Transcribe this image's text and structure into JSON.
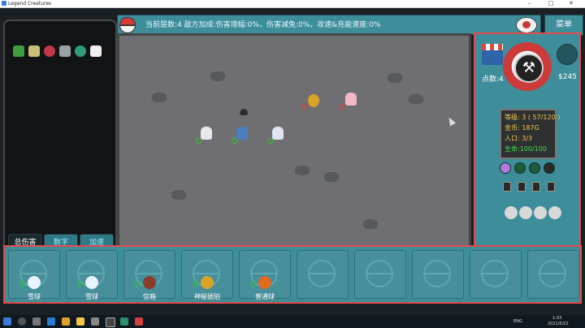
{
  "window": {
    "title": "Legend Creatures"
  },
  "topbar": {
    "info": "当前层数:4 敌方加成:伤害增幅:0%，伤害减免:0%，攻速&充能速度:0%"
  },
  "menu_label": "菜单",
  "left_panel": {
    "items": [
      "book-icon",
      "stack-icon",
      "berry-icon",
      "net-icon",
      "orb-icon",
      "wing-icon"
    ],
    "buttons": {
      "damage": "总伤害",
      "number": "数字",
      "speed": "加速"
    }
  },
  "right_panel": {
    "points": "点数:4",
    "money": "$245",
    "stats": {
      "level": "等级: 3 ( 57/120 )",
      "gold": "金币: 187G",
      "population": "人口: 3/3",
      "life": "生命:100/100"
    }
  },
  "bench": {
    "slots": [
      {
        "label": "雪球",
        "color": "#e9f2ff"
      },
      {
        "label": "雪球",
        "color": "#e9f2ff"
      },
      {
        "label": "信箱",
        "color": "#8b3b2b"
      },
      {
        "label": "神秘琥珀",
        "color": "#d9a326"
      },
      {
        "label": "普通球",
        "color": "#e06a1e"
      },
      {
        "label": "",
        "color": ""
      },
      {
        "label": "",
        "color": ""
      },
      {
        "label": "",
        "color": ""
      },
      {
        "label": "",
        "color": ""
      },
      {
        "label": "",
        "color": ""
      }
    ]
  },
  "taskbar": {
    "time": "1:03",
    "date": "2021/6/22",
    "lang": "ENG"
  }
}
